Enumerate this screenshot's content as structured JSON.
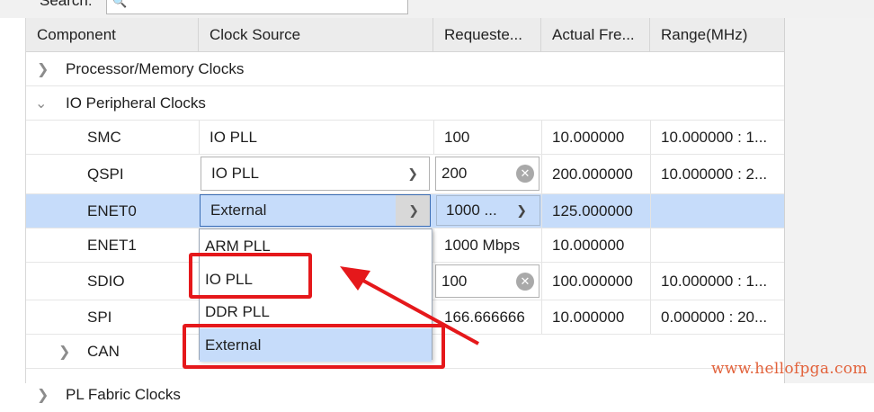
{
  "search": {
    "label": "Search:",
    "placeholder": ""
  },
  "columns": [
    "Component",
    "Clock Source",
    "Requeste...",
    "Actual Fre...",
    "Range(MHz)"
  ],
  "rows": [
    {
      "component": "Processor/Memory Clocks",
      "expander": "collapsed",
      "source": "",
      "requested": "",
      "actual": "",
      "range": ""
    },
    {
      "component": "IO Peripheral Clocks",
      "expander": "expanded",
      "source": "",
      "requested": "",
      "actual": "",
      "range": ""
    },
    {
      "component": "SMC",
      "source": "IO PLL",
      "requested": "100",
      "actual": "10.000000",
      "range": "10.000000 : 1..."
    },
    {
      "component": "QSPI",
      "source": "IO PLL",
      "requested": "200",
      "actual": "200.000000",
      "range": "10.000000 : 2..."
    },
    {
      "component": "ENET0",
      "source": "External",
      "requested": "1000 ...",
      "actual": "125.000000",
      "range": ""
    },
    {
      "component": "ENET1",
      "source": "",
      "requested": "1000 Mbps",
      "actual": "10.000000",
      "range": ""
    },
    {
      "component": "SDIO",
      "source": "",
      "requested": "100",
      "actual": "100.000000",
      "range": "10.000000 : 1..."
    },
    {
      "component": "SPI",
      "source": "",
      "requested": "166.666666",
      "actual": "10.000000",
      "range": "0.000000 : 20..."
    },
    {
      "component": "CAN",
      "expander": "collapsed",
      "source": "",
      "requested": "",
      "actual": "",
      "range": ""
    },
    {
      "component": "PL Fabric Clocks",
      "expander": "collapsed",
      "source": "",
      "requested": "",
      "actual": "",
      "range": ""
    }
  ],
  "dropdown_options": [
    "ARM PLL",
    "IO PLL",
    "DDR PLL",
    "External"
  ],
  "dropdown_highlighted": "External",
  "selected_row": "ENET0",
  "watermark": "www.hellofpga.com",
  "colors": {
    "selection": "#c6dcfa",
    "annotation": "#e5181b",
    "watermark": "#e2623b"
  }
}
